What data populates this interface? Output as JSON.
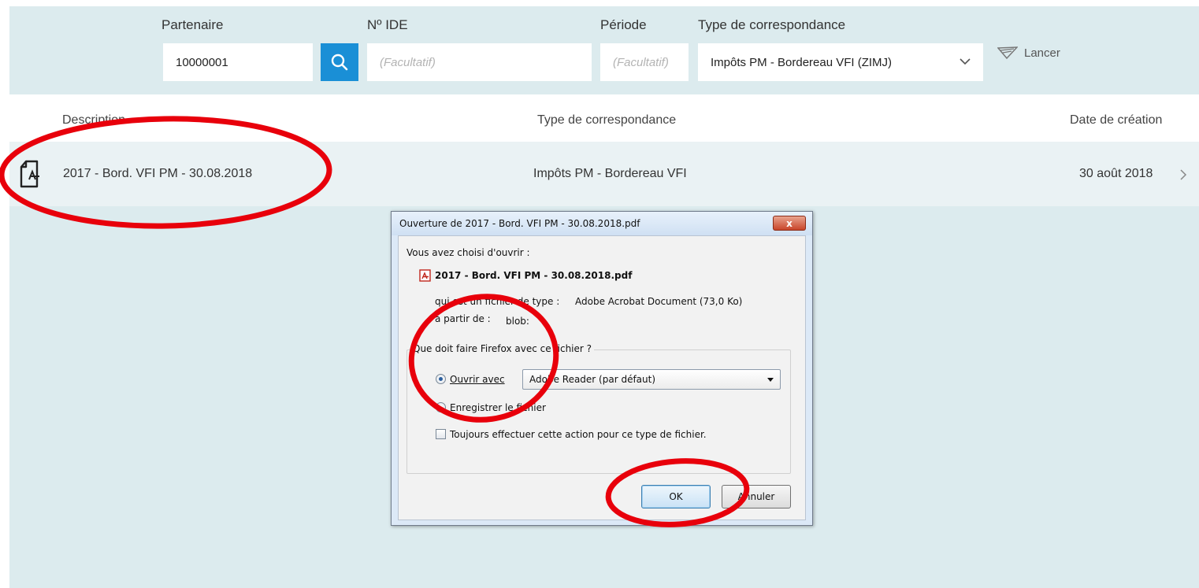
{
  "filters": {
    "partenaire": {
      "label": "Partenaire",
      "value": "10000001"
    },
    "ide": {
      "label": "Nº IDE",
      "placeholder": "(Facultatif)"
    },
    "periode": {
      "label": "Période",
      "placeholder": "(Facultatif)"
    },
    "type": {
      "label": "Type de correspondance",
      "value": "Impôts PM - Bordereau VFI (ZIMJ)"
    },
    "launch_label": "Lancer"
  },
  "table": {
    "headers": {
      "description": "Description",
      "type": "Type de correspondance",
      "date": "Date de création"
    },
    "rows": [
      {
        "description": "2017 - Bord. VFI PM - 30.08.2018",
        "type": "Impôts PM - Bordereau VFI",
        "date": "30 août 2018"
      }
    ]
  },
  "dialog": {
    "title": "Ouverture de 2017 - Bord. VFI PM - 30.08.2018.pdf",
    "close_label": "x",
    "intro": "Vous avez choisi d'ouvrir :",
    "filename": "2017 - Bord. VFI PM - 30.08.2018.pdf",
    "type_label": "qui est un fichier de type :",
    "type_value": "Adobe Acrobat Document (73,0 Ko)",
    "from_label": "à partir de :",
    "from_value": "blob:",
    "group_label": "Que doit faire Firefox avec ce fichier ?",
    "open_with_label": "Ouvrir avec",
    "open_with_app": "Adobe Reader  (par défaut)",
    "save_label": "Enregistrer le fichier",
    "always_label": "Toujours effectuer cette action pour ce type de fichier.",
    "ok_label": "OK",
    "cancel_label": "Annuler"
  },
  "colors": {
    "filter_bg": "#dcebee",
    "accent": "#1a8fd6",
    "row_bg": "#eaf2f4",
    "annotation": "#e8000b"
  }
}
